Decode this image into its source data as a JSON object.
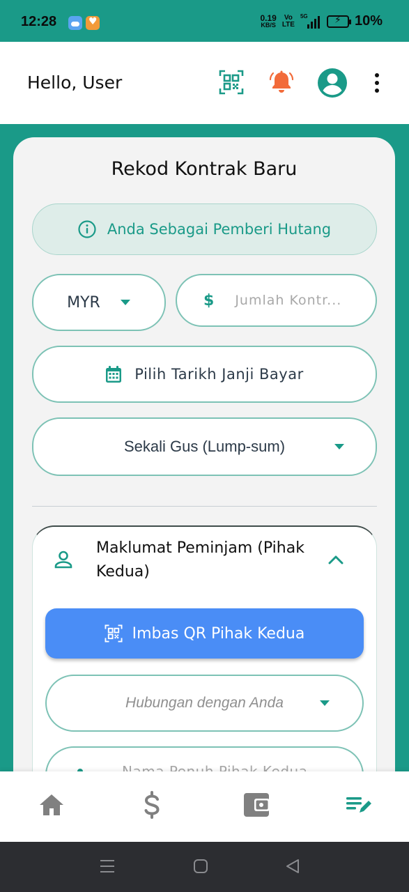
{
  "status_bar": {
    "time": "12:28",
    "net_speed": "0.19",
    "net_speed_unit": "KB/S",
    "volte_top": "Vo",
    "volte_bottom": "LTE",
    "network": "5G",
    "battery": "10%"
  },
  "header": {
    "greeting": "Hello, User",
    "icons": [
      "qr-scan-icon",
      "bell-icon",
      "account-icon",
      "more-vert-icon"
    ]
  },
  "form": {
    "title": "Rekod Kontrak Baru",
    "role_notice": "Anda Sebagai Pemberi Hutang",
    "currency": "MYR",
    "amount_placeholder": "Jumlah Kontr...",
    "date_button": "Pilih Tarikh Janji Bayar",
    "payment_type": "Sekali Gus (Lump-sum)"
  },
  "borrower": {
    "title": "Maklumat Peminjam (Pihak Kedua)",
    "scan_button": "Imbas QR Pihak Kedua",
    "relationship_placeholder": "Hubungan dengan Anda",
    "full_name_placeholder": "Nama Penuh Pihak Kedua"
  },
  "bottom_nav": [
    "home-icon",
    "dollar-icon",
    "wallet-icon",
    "edit-note-icon"
  ],
  "colors": {
    "primary": "#1a9a88",
    "scan_button": "#4a8df6",
    "bell": "#f26b3a",
    "field_border": "#7dc2b5"
  }
}
